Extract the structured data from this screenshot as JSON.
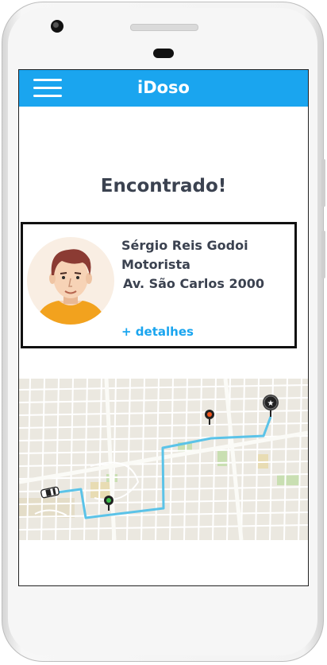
{
  "app": {
    "title": "iDoso"
  },
  "status": {
    "heading": "Encontrado!"
  },
  "driver": {
    "name": "Sérgio Reis Godoi",
    "role": "Motorista",
    "address": "Av. São Carlos 2000",
    "details_link": "+ detalhes"
  },
  "icons": {
    "menu": "hamburger-menu-icon",
    "car": "car-icon",
    "start": "green-pin-icon",
    "stop": "red-pin-icon",
    "destination": "star-pin-icon"
  },
  "colors": {
    "app_bar": "#1aa5ef",
    "link": "#1aa5ef",
    "route": "#5bc3e8",
    "text": "#3b4250"
  }
}
